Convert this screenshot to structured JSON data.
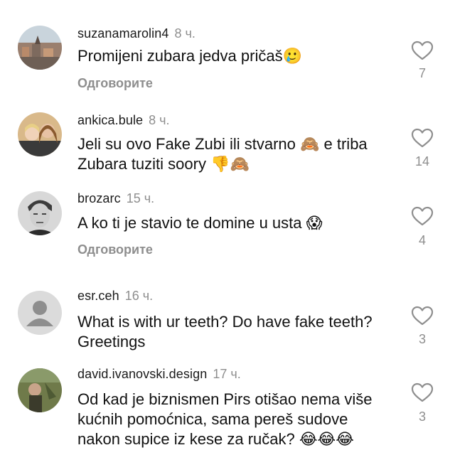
{
  "comments": [
    {
      "username": "suzanamarolin4",
      "time": "8 ч.",
      "text": "Promijeni zubara jedva pričaš🥲",
      "reply_label": "Одговорите",
      "likes": "7",
      "avatar": "city-photo"
    },
    {
      "username": "ankica.bule",
      "time": "8 ч.",
      "text": "Jeli su ovo Fake Zubi ili stvarno 🙈 e triba Zubara tuziti soory 👎🙈",
      "reply_label": "",
      "likes": "14",
      "avatar": "two-people-photo"
    },
    {
      "username": "brozarc",
      "time": "15 ч.",
      "text": "A ko ti je stavio te domine u usta 😱",
      "reply_label": "Одговорите",
      "likes": "4",
      "avatar": "man-portrait-photo"
    },
    {
      "username": "esr.ceh",
      "time": "16 ч.",
      "text": "What is with ur teeth? Do have fake teeth? Greetings",
      "reply_label": "",
      "likes": "3",
      "avatar": "default-avatar"
    },
    {
      "username": "david.ivanovski.design",
      "time": "17 ч.",
      "text": "Od kad je biznismen Pirs otišao nema više kućnih pomoćnica, sama pereš sudove nakon supice iz kese za ručak? 😂😂😂",
      "reply_label": "",
      "likes": "3",
      "avatar": "outdoor-photo"
    }
  ],
  "icons": {
    "like": "heart-outline-icon"
  },
  "colors": {
    "secondary_text": "#8e8e8e",
    "primary_text": "#111111"
  }
}
